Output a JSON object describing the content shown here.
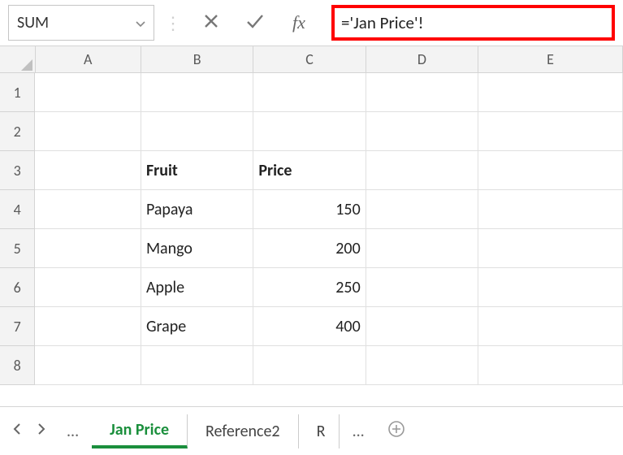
{
  "formula_bar": {
    "name_box": "SUM",
    "formula": "='Jan Price'!"
  },
  "columns": [
    "A",
    "B",
    "C",
    "D",
    "E"
  ],
  "rows": [
    {
      "num": "1",
      "B": "",
      "C": ""
    },
    {
      "num": "2",
      "B": "",
      "C": ""
    },
    {
      "num": "3",
      "B": "Fruit",
      "C": "Price"
    },
    {
      "num": "4",
      "B": "Papaya",
      "C": "150"
    },
    {
      "num": "5",
      "B": "Mango",
      "C": "200"
    },
    {
      "num": "6",
      "B": "Apple",
      "C": "250"
    },
    {
      "num": "7",
      "B": "Grape",
      "C": "400"
    },
    {
      "num": "8",
      "B": "",
      "C": ""
    }
  ],
  "sheet_tabs": {
    "active": "Jan Price",
    "tab2": "Reference2",
    "tab3": "R",
    "ellipsis": "..."
  },
  "fx_label": "fx",
  "chart_data": {
    "type": "table",
    "title": "",
    "columns": [
      "Fruit",
      "Price"
    ],
    "data": [
      {
        "Fruit": "Papaya",
        "Price": 150
      },
      {
        "Fruit": "Mango",
        "Price": 200
      },
      {
        "Fruit": "Apple",
        "Price": 250
      },
      {
        "Fruit": "Grape",
        "Price": 400
      }
    ]
  }
}
